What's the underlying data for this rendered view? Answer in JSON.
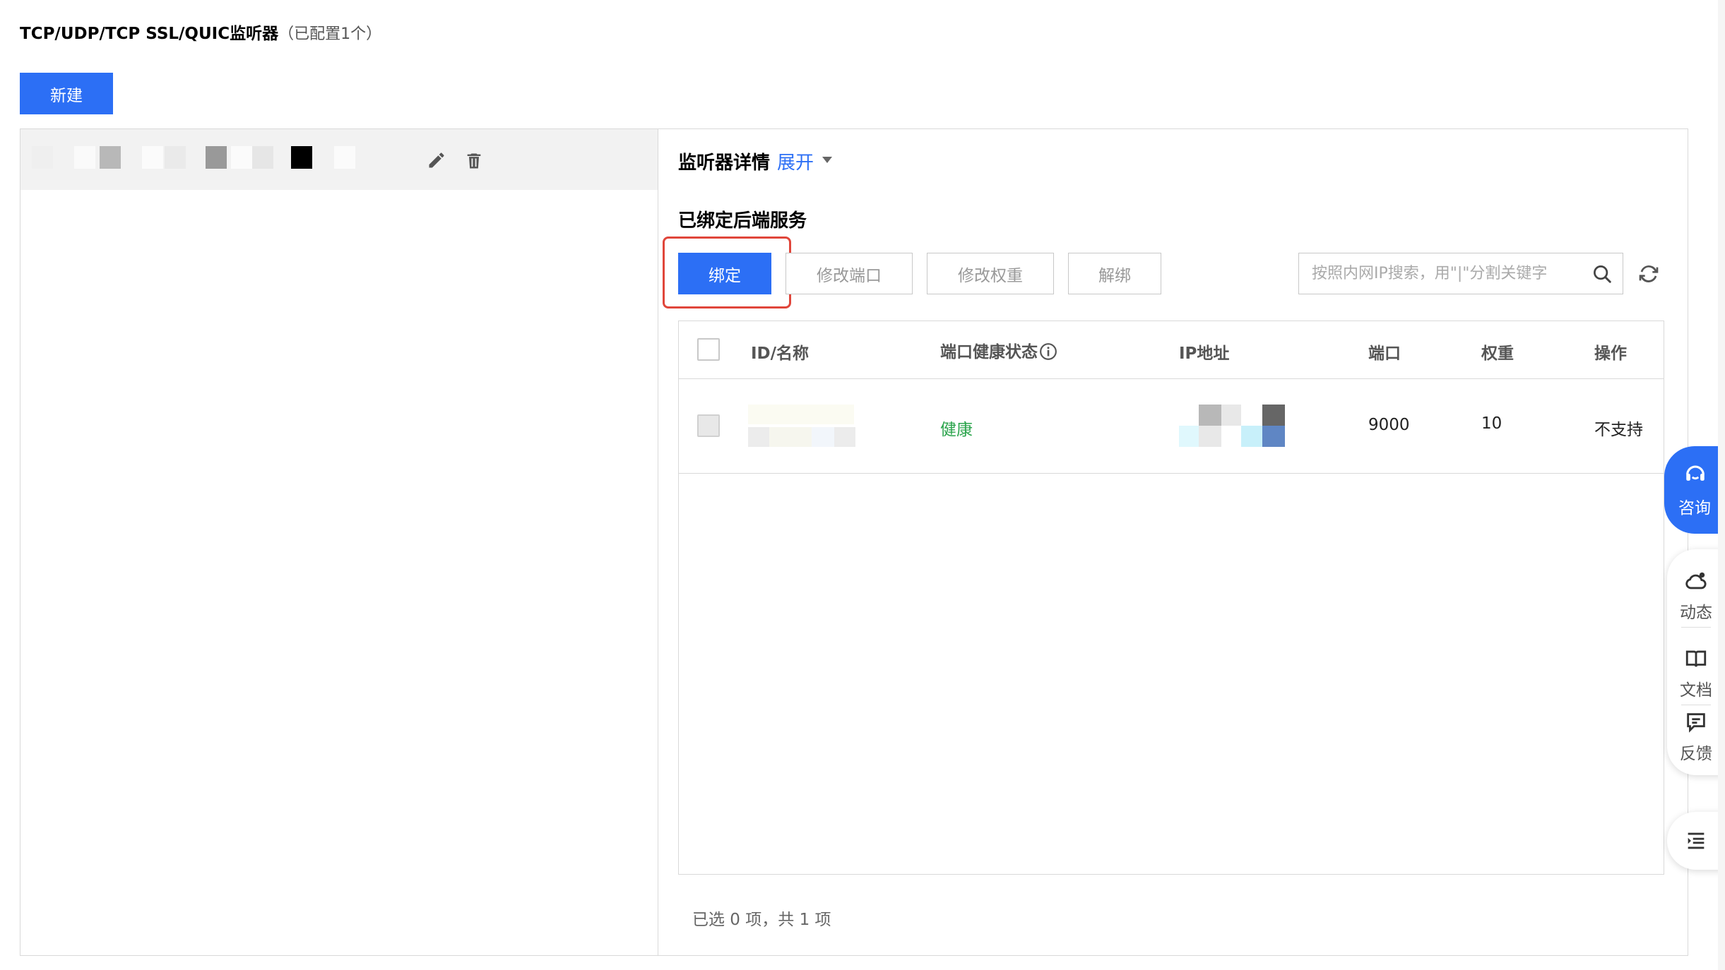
{
  "header": {
    "title": "TCP/UDP/TCP SSL/QUIC监听器",
    "count_label": "（已配置1个）"
  },
  "toolbar": {
    "new_label": "新建"
  },
  "listener_detail": {
    "title": "监听器详情",
    "expand_label": "展开"
  },
  "backend": {
    "section_title": "已绑定后端服务",
    "bind_label": "绑定",
    "modify_port_label": "修改端口",
    "modify_weight_label": "修改权重",
    "unbind_label": "解绑",
    "search_placeholder": "按照内网IP搜索，用\"|\"分割关键字"
  },
  "table": {
    "columns": [
      "ID/名称",
      "端口健康状态",
      "IP地址",
      "端口",
      "权重",
      "操作"
    ],
    "rows": [
      {
        "id_name": "",
        "health": "健康",
        "ip": "",
        "port": "9000",
        "weight": "10",
        "action": "不支持"
      }
    ]
  },
  "footer": {
    "selection_text": "已选 0 项，共 1 项"
  },
  "float_tools": {
    "consult": "咨询",
    "dynamic": "动态",
    "docs": "文档",
    "feedback": "反馈"
  },
  "colors": {
    "primary": "#2c6ff5",
    "health": "#2ba44c",
    "highlight": "#e0463b"
  },
  "icons": [
    "edit-icon",
    "trash-icon",
    "caret-down-icon",
    "search-icon",
    "refresh-icon",
    "info-icon",
    "headset-icon",
    "cloud-icon",
    "book-icon",
    "message-icon",
    "menu-icon"
  ]
}
